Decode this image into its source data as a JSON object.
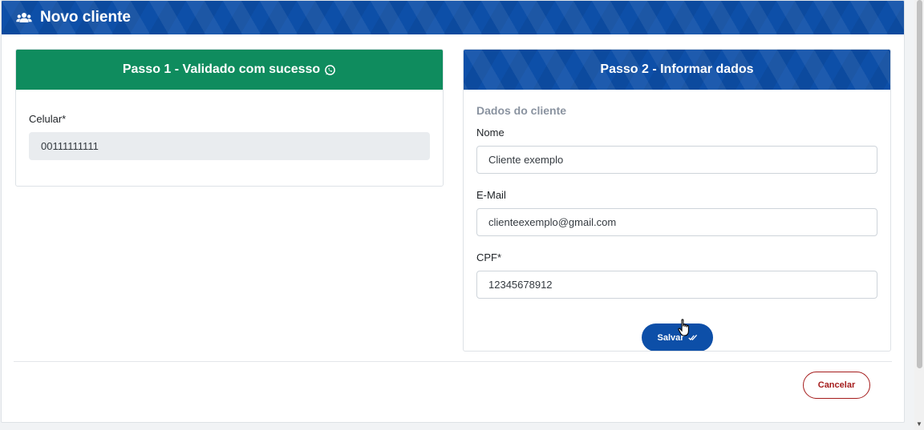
{
  "header": {
    "title": "Novo cliente",
    "icon": "users-icon"
  },
  "step1": {
    "title": "Passo 1 - Validado com sucesso",
    "title_icon": "whatsapp-icon",
    "header_color": "#0f8c5e",
    "phone_label": "Celular*",
    "phone_value": "00111111111"
  },
  "step2": {
    "title": "Passo 2 - Informar dados",
    "section_title": "Dados do cliente",
    "name_label": "Nome",
    "name_value": "Cliente exemplo",
    "email_label": "E-Mail",
    "email_value": "clienteexemplo@gmail.com",
    "cpf_label": "CPF*",
    "cpf_value": "12345678912",
    "save_label": "Salvar",
    "save_icon": "double-check-icon"
  },
  "footer": {
    "cancel_label": "Cancelar",
    "cancel_color": "#a51c1c"
  },
  "colors": {
    "primary": "#0d4fa8",
    "success": "#0f8c5e"
  }
}
